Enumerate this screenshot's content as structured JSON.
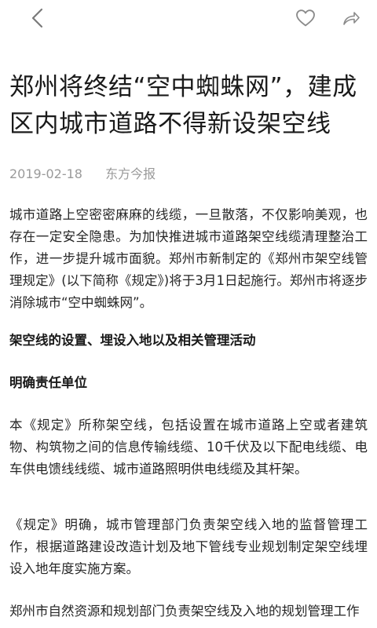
{
  "topbar": {
    "back_icon": "chevron-left-icon",
    "like_icon": "heart-outline-icon",
    "share_icon": "share-arrow-icon",
    "icon_color": "#7a7a7a"
  },
  "article": {
    "title": "郑州将终结“空中蜘蛛网”，建成区内城市道路不得新设架空线",
    "date": "2019-02-18",
    "source": "东方今报",
    "paragraph_1": "城市道路上空密密麻麻的线缆，一旦散落，不仅影响美观，也存在一定安全隐患。为加快推进城市道路架空线缆清理整治工作，进一步提升城市面貌。郑州市新制定的《郑州市架空线管理规定》(以下简称《规定》)将于3月1日起施行。郑州市将逐步消除城市“空中蜘蛛网”。",
    "heading_1": "架空线的设置、埋设入地以及相关管理活动",
    "heading_2": "明确责任单位",
    "paragraph_2": "本《规定》所称架空线，包括设置在城市道路上空或者建筑物、构筑物之间的信息传输线缆、10千伏及以下配电线缆、电车供电馈线线缆、城市道路照明供电线缆及其杆架。",
    "paragraph_3": "《规定》明确，城市管理部门负责架空线入地的监督管理工作，根据道路建设改造计划及地下管线专业规划制定架空线埋设入地年度实施方案。",
    "paragraph_4": "郑州市自然资源和规划部门负责架空线及入地的规划管理工作"
  }
}
